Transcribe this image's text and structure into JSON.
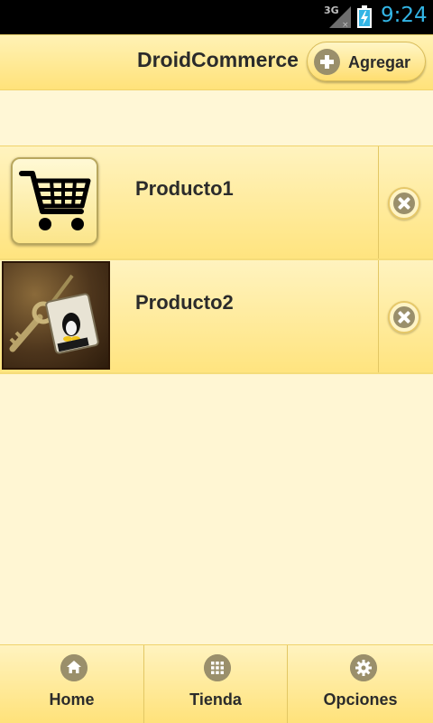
{
  "status_bar": {
    "network": "3G",
    "time": "9:24"
  },
  "header": {
    "title": "DroidCommerce",
    "add_label": "Agregar"
  },
  "products": [
    {
      "name": "Producto1",
      "thumb_icon": "shopping-cart-icon"
    },
    {
      "name": "Producto2",
      "thumb_icon": "linux-keychain-photo"
    }
  ],
  "tabs": [
    {
      "label": "Home",
      "icon": "home-icon"
    },
    {
      "label": "Tienda",
      "icon": "grid-icon"
    },
    {
      "label": "Opciones",
      "icon": "gear-icon"
    }
  ],
  "colors": {
    "status_time": "#33b5e5",
    "bar_gradient_top": "#fff3bf",
    "bar_gradient_bottom": "#ffe27a",
    "icon_fill": "#9a8f6b"
  }
}
